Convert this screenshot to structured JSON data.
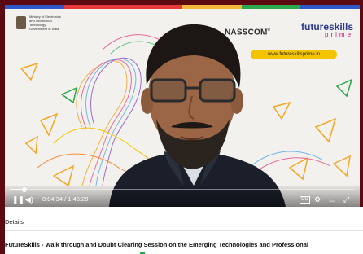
{
  "video": {
    "header": {
      "ministry_text": "Ministry of Electronics and Information Technology Government of India",
      "nasscom": "NASSCOM",
      "nasscom_reg": "®",
      "brand_line1": "futureskills",
      "brand_line2": "prime",
      "url": "www.futureskillsprime.in",
      "stripe_colors": [
        "#2f59c8",
        "#e63a3a",
        "#e63a3a",
        "#f1b83c",
        "#2aa84a",
        "#2f59c8"
      ]
    },
    "player": {
      "current_time": "0:04:34",
      "separator": "/",
      "duration": "1:45:28",
      "progress": 0.043,
      "play_pause_icon": "pause-icon",
      "volume_icon": "volume-icon",
      "cc_icon": "captions-icon",
      "settings_icon": "gear-icon",
      "theater_icon": "theater-icon",
      "fullscreen_icon": "fullscreen-icon",
      "pause_glyph": "❚❚",
      "volume_glyph": "◀)",
      "cc_glyph": "CC",
      "settings_glyph": "⚙",
      "theater_glyph": "▭",
      "fullscreen_glyph": "⤢"
    }
  },
  "details": {
    "tab_label": "Details",
    "title": "FutureSkills - Walk through and Doubt Clearing Session on the Emerging Technologies and Professional"
  },
  "colors": {
    "background": "#5a0a10",
    "accent": "#cc0000",
    "progress": "#ffffff"
  }
}
